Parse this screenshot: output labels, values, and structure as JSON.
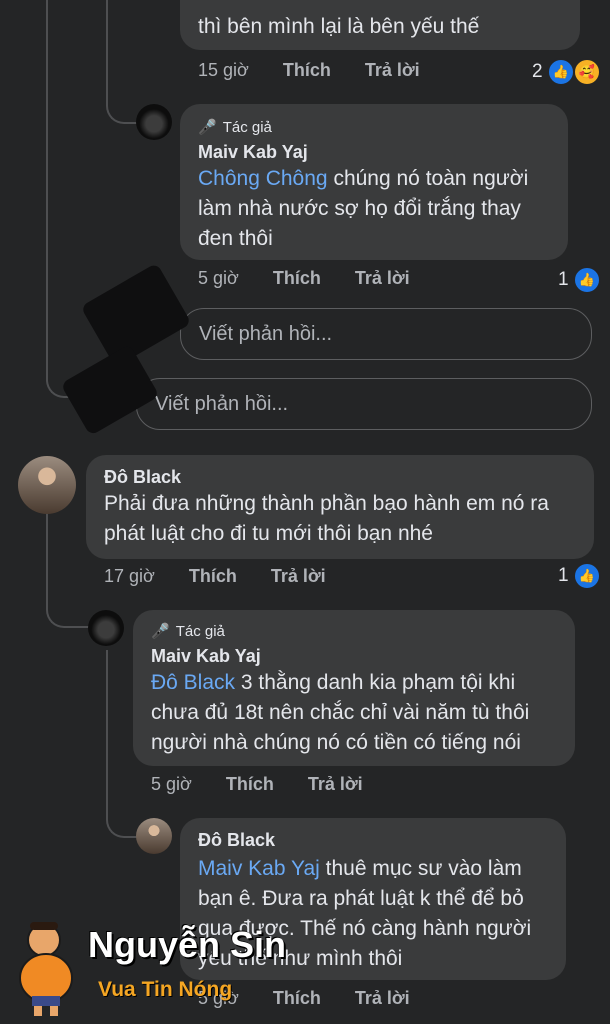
{
  "c1": {
    "text_tail": "thì bên mình lại là bên yếu thế",
    "time": "15 giờ",
    "like_label": "Thích",
    "reply_label": "Trả lời",
    "reaction_count": "2"
  },
  "r1": {
    "author_badge": "Tác giả",
    "name": "Maiv Kab Yaj",
    "mention": "Chông Chông",
    "line1": " chúng nó toàn người",
    "line2": "làm nhà nước sợ họ đổi trắng thay",
    "line3": "đen thôi",
    "time": "5 giờ",
    "like_label": "Thích",
    "reply_label": "Trả lời",
    "reaction_count": "1"
  },
  "reply_box_1": {
    "placeholder": "Viết phản hồi..."
  },
  "reply_box_2": {
    "placeholder": "Viết phản hồi..."
  },
  "c2": {
    "name": "Đô Black",
    "line1": "Phải đưa những thành phần bạo hành em nó ra",
    "line2": "phát luật cho đi tu mới thôi bạn nhé",
    "time": "17 giờ",
    "like_label": "Thích",
    "reply_label": "Trả lời",
    "reaction_count": "1"
  },
  "r2": {
    "author_badge": "Tác giả",
    "name": "Maiv Kab Yaj",
    "mention": "Đô Black",
    "line1": " 3 thằng danh kia phạm tội khi",
    "line2": "chưa đủ 18t nên chắc chỉ vài năm tù thôi",
    "line3": "người nhà chúng nó có tiền có tiếng nói",
    "time": "5 giờ",
    "like_label": "Thích",
    "reply_label": "Trả lời"
  },
  "r3": {
    "name": "Đô Black",
    "mention": "Maiv Kab Yaj",
    "line1": " thuê mục sư vào làm",
    "line2": "bạn ê. Đưa ra phát luật k thể để bỏ",
    "line3": "qua được. Thế nó càng hành người",
    "line4": "yếu thế như mình thôi",
    "time": "5 giờ",
    "like_label": "Thích",
    "reply_label": "Trả lời"
  },
  "watermark": {
    "title": "Nguyễn Sin",
    "subtitle": "Vua Tin Nóng"
  },
  "colors": {
    "background": "#242526",
    "bubble": "#3a3b3c",
    "mention": "#6aa9f4",
    "like": "#1b74e4",
    "watermark_title": "#ffffff",
    "watermark_subtitle": "#f5a623"
  }
}
